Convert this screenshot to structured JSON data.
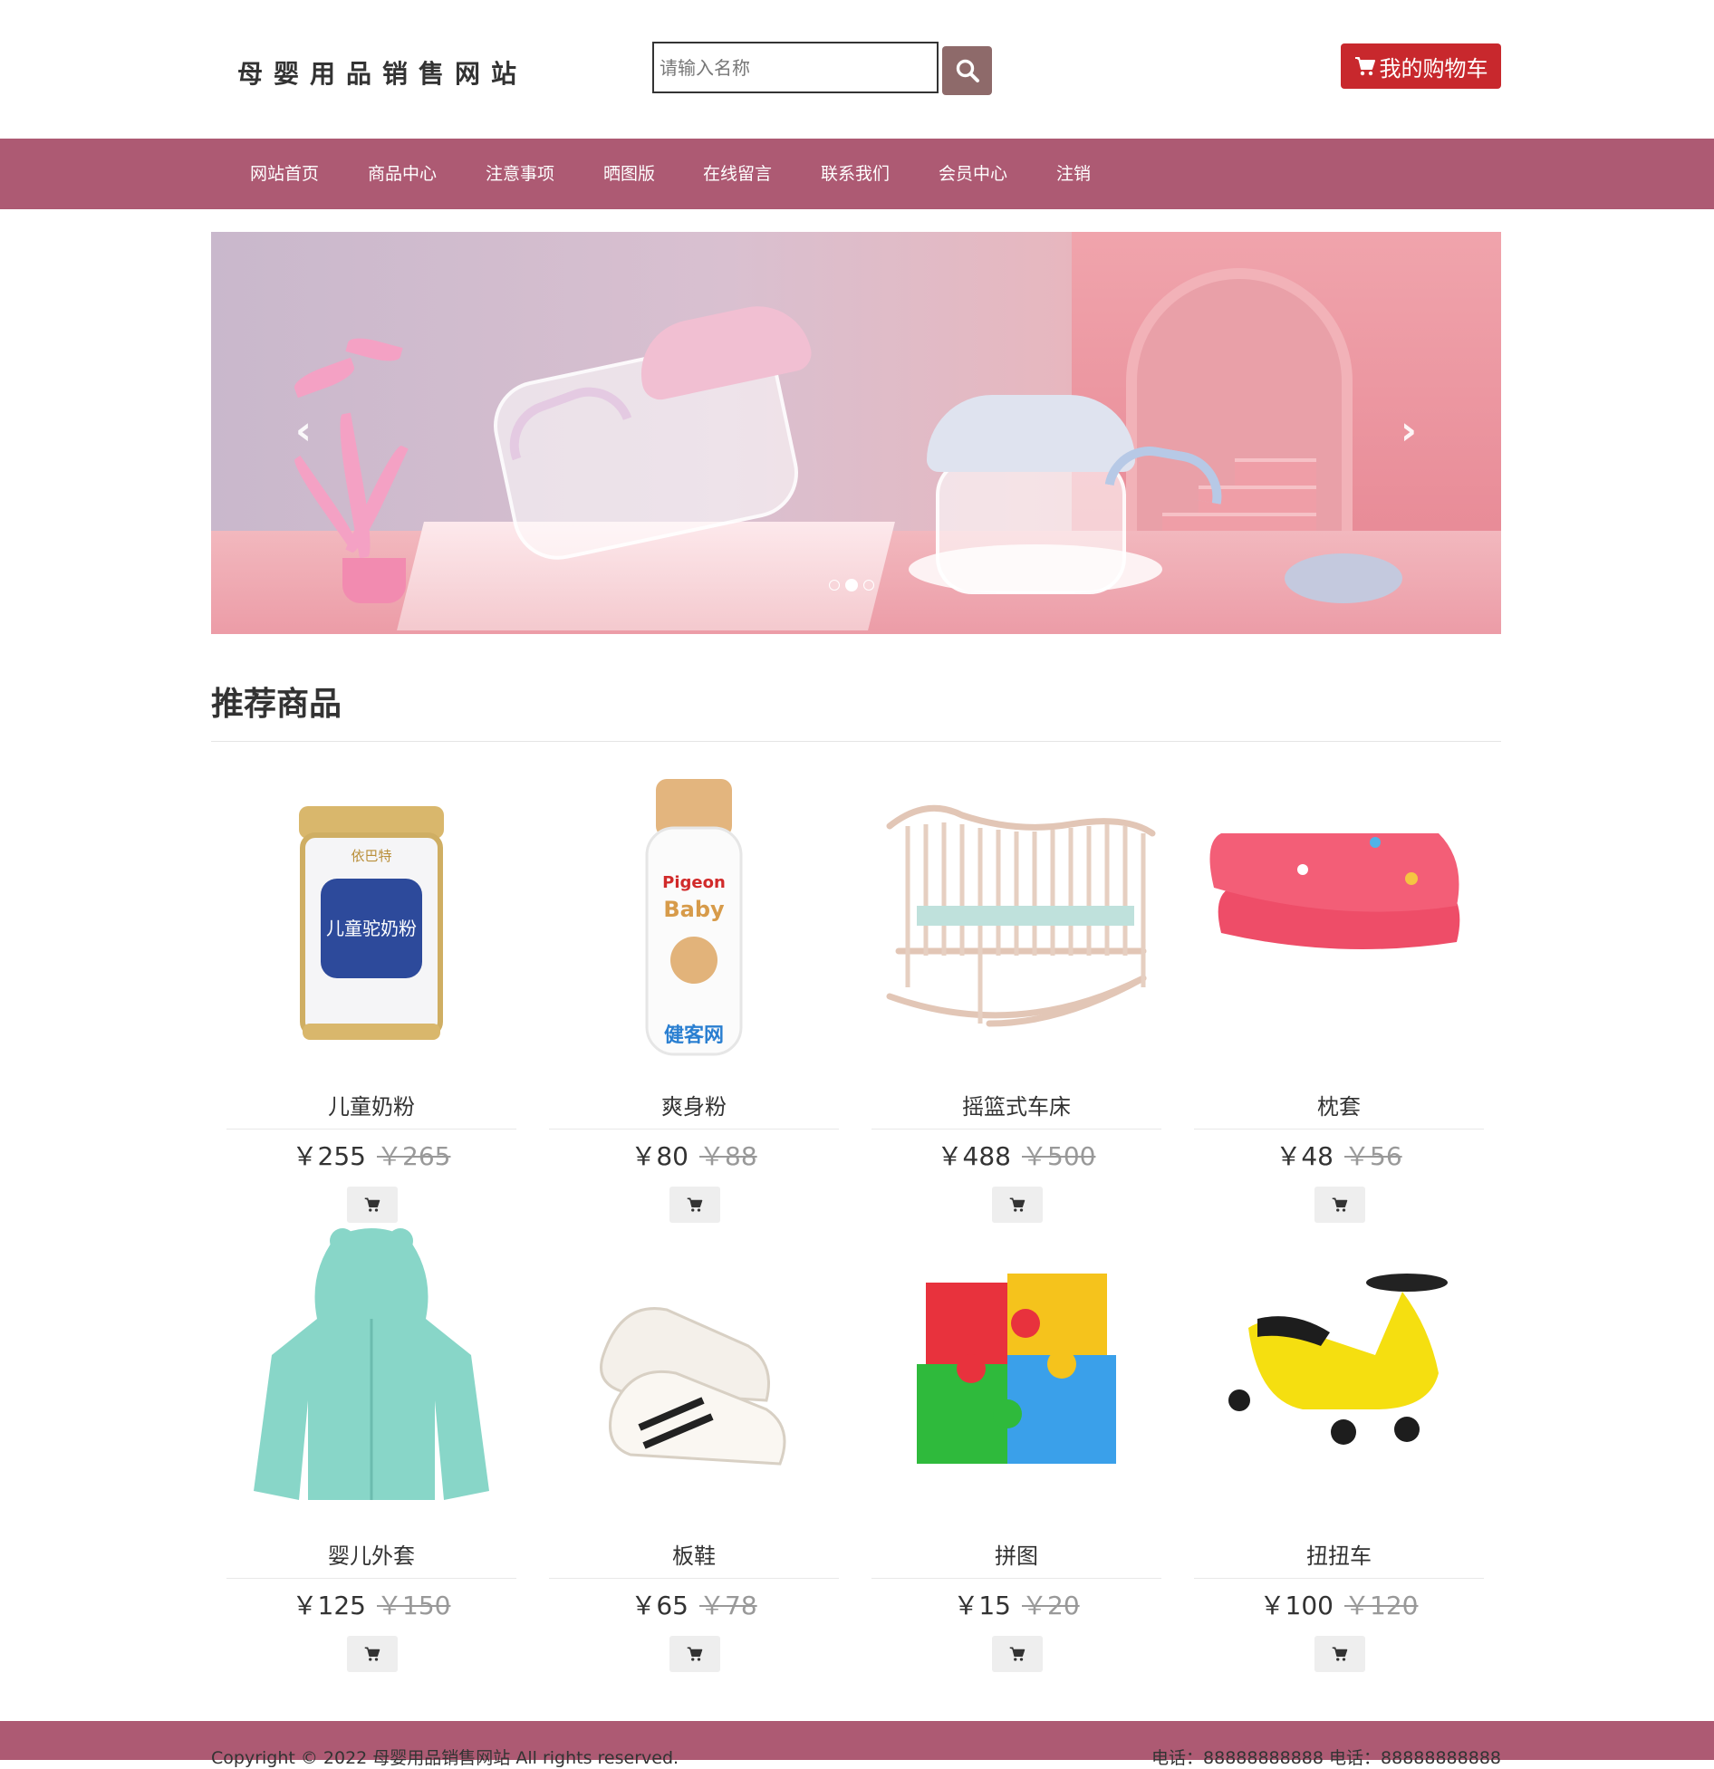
{
  "header": {
    "logo": "母婴用品销售网站",
    "search_placeholder": "请输入名称",
    "cart_label": "我的购物车"
  },
  "nav": {
    "items": [
      {
        "label": "网站首页"
      },
      {
        "label": "商品中心"
      },
      {
        "label": "注意事项"
      },
      {
        "label": "晒图版"
      },
      {
        "label": "在线留言"
      },
      {
        "label": "联系我们"
      },
      {
        "label": "会员中心"
      },
      {
        "label": "注销"
      }
    ]
  },
  "carousel": {
    "prev": "‹",
    "next": "›",
    "slides": 3,
    "active_slide": 2
  },
  "section": {
    "title": "推荐商品"
  },
  "products": [
    {
      "name": "儿童奶粉",
      "price": "￥255",
      "old_price": "￥265",
      "image": "milk-powder-can"
    },
    {
      "name": "爽身粉",
      "price": "￥80",
      "old_price": "￥88",
      "image": "baby-powder-bottle"
    },
    {
      "name": "摇篮式车床",
      "price": "￥488",
      "old_price": "￥500",
      "image": "wooden-cradle-crib"
    },
    {
      "name": "枕套",
      "price": "￥48",
      "old_price": "￥56",
      "image": "pink-pillowcase"
    },
    {
      "name": "婴儿外套",
      "price": "￥125",
      "old_price": "￥150",
      "image": "mint-hooded-jacket"
    },
    {
      "name": "板鞋",
      "price": "￥65",
      "old_price": "￥78",
      "image": "white-sneakers"
    },
    {
      "name": "拼图",
      "price": "￥15",
      "old_price": "￥20",
      "image": "jigsaw-puzzle"
    },
    {
      "name": "扭扭车",
      "price": "￥100",
      "old_price": "￥120",
      "image": "yellow-swing-car"
    }
  ],
  "footer": {
    "copyright": "Copyright © 2022 母婴用品销售网站 All rights reserved.",
    "phones": "电话：88888888888   电话：88888888888"
  },
  "colors": {
    "nav_bg": "#ad5a73",
    "cart_button": "#c8282d",
    "search_button": "#8e6a6a"
  }
}
